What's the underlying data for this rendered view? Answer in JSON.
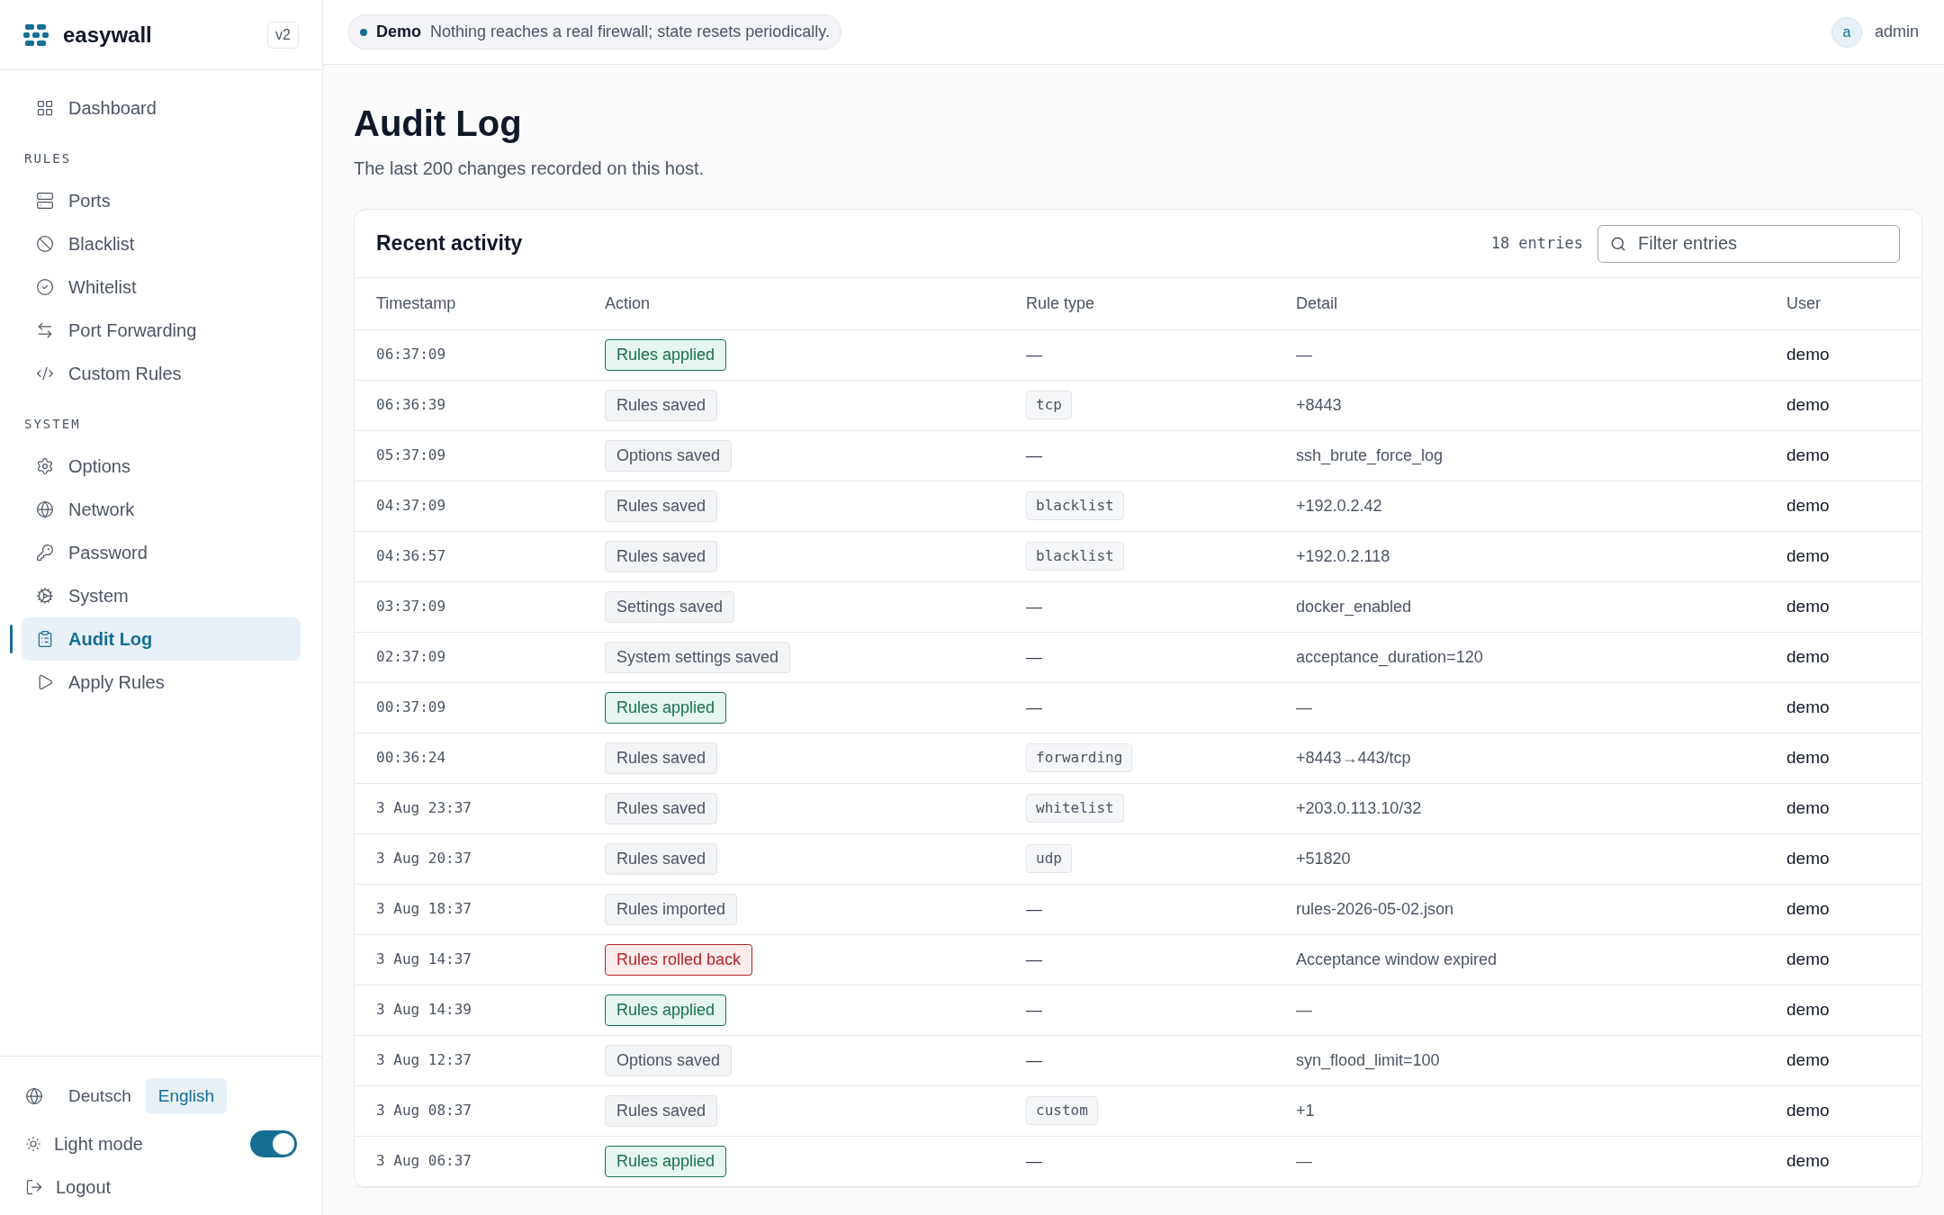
{
  "brand": {
    "name": "easywall",
    "version": "v2"
  },
  "sidebar": {
    "items": [
      {
        "label": "Dashboard",
        "selected": false
      }
    ],
    "sections": [
      {
        "heading": "RULES",
        "items": [
          {
            "label": "Ports",
            "selected": false
          },
          {
            "label": "Blacklist",
            "selected": false
          },
          {
            "label": "Whitelist",
            "selected": false
          },
          {
            "label": "Port Forwarding",
            "selected": false
          },
          {
            "label": "Custom Rules",
            "selected": false
          }
        ]
      },
      {
        "heading": "SYSTEM",
        "items": [
          {
            "label": "Options",
            "selected": false
          },
          {
            "label": "Network",
            "selected": false
          },
          {
            "label": "Password",
            "selected": false
          },
          {
            "label": "System",
            "selected": false
          },
          {
            "label": "Audit Log",
            "selected": true
          },
          {
            "label": "Apply Rules",
            "selected": false
          }
        ]
      }
    ],
    "languages": [
      {
        "label": "Deutsch",
        "selected": false
      },
      {
        "label": "English",
        "selected": true
      }
    ],
    "light_mode": {
      "label": "Light mode",
      "on": true
    },
    "logout": "Logout"
  },
  "banner": {
    "badge": "Demo",
    "text": "Nothing reaches a real firewall; state resets periodically."
  },
  "user": {
    "avatar": "a",
    "name": "admin"
  },
  "page": {
    "title": "Audit Log",
    "subtitle": "The last 200 changes recorded on this host."
  },
  "card": {
    "title": "Recent activity",
    "count": "18 entries",
    "search": {
      "placeholder": "Filter entries"
    }
  },
  "table": {
    "columns": [
      "Timestamp",
      "Action",
      "Rule type",
      "Detail",
      "User"
    ],
    "rows": [
      {
        "timestamp": "06:37:09",
        "action": {
          "text": "Rules applied",
          "kind": "success"
        },
        "rule_type": {
          "text": "—",
          "kind": "plain"
        },
        "detail": "—",
        "user": "demo"
      },
      {
        "timestamp": "06:36:39",
        "action": {
          "text": "Rules saved",
          "kind": "neutral"
        },
        "rule_type": {
          "text": "tcp",
          "kind": "tag"
        },
        "detail": "+8443",
        "user": "demo"
      },
      {
        "timestamp": "05:37:09",
        "action": {
          "text": "Options saved",
          "kind": "neutral"
        },
        "rule_type": {
          "text": "—",
          "kind": "plain"
        },
        "detail": "ssh_brute_force_log",
        "user": "demo"
      },
      {
        "timestamp": "04:37:09",
        "action": {
          "text": "Rules saved",
          "kind": "neutral"
        },
        "rule_type": {
          "text": "blacklist",
          "kind": "tag"
        },
        "detail": "+192.0.2.42",
        "user": "demo"
      },
      {
        "timestamp": "04:36:57",
        "action": {
          "text": "Rules saved",
          "kind": "neutral"
        },
        "rule_type": {
          "text": "blacklist",
          "kind": "tag"
        },
        "detail": "+192.0.2.118",
        "user": "demo"
      },
      {
        "timestamp": "03:37:09",
        "action": {
          "text": "Settings saved",
          "kind": "neutral"
        },
        "rule_type": {
          "text": "—",
          "kind": "plain"
        },
        "detail": "docker_enabled",
        "user": "demo"
      },
      {
        "timestamp": "02:37:09",
        "action": {
          "text": "System settings saved",
          "kind": "neutral"
        },
        "rule_type": {
          "text": "—",
          "kind": "plain"
        },
        "detail": "acceptance_duration=120",
        "user": "demo"
      },
      {
        "timestamp": "00:37:09",
        "action": {
          "text": "Rules applied",
          "kind": "success"
        },
        "rule_type": {
          "text": "—",
          "kind": "plain"
        },
        "detail": "—",
        "user": "demo"
      },
      {
        "timestamp": "00:36:24",
        "action": {
          "text": "Rules saved",
          "kind": "neutral"
        },
        "rule_type": {
          "text": "forwarding",
          "kind": "tag"
        },
        "detail": "+8443→443/tcp",
        "user": "demo"
      },
      {
        "timestamp": "3 Aug 23:37",
        "action": {
          "text": "Rules saved",
          "kind": "neutral"
        },
        "rule_type": {
          "text": "whitelist",
          "kind": "tag"
        },
        "detail": "+203.0.113.10/32",
        "user": "demo"
      },
      {
        "timestamp": "3 Aug 20:37",
        "action": {
          "text": "Rules saved",
          "kind": "neutral"
        },
        "rule_type": {
          "text": "udp",
          "kind": "tag"
        },
        "detail": "+51820",
        "user": "demo"
      },
      {
        "timestamp": "3 Aug 18:37",
        "action": {
          "text": "Rules imported",
          "kind": "neutral"
        },
        "rule_type": {
          "text": "—",
          "kind": "plain"
        },
        "detail": "rules-2026-05-02.json",
        "user": "demo"
      },
      {
        "timestamp": "3 Aug 14:37",
        "action": {
          "text": "Rules rolled back",
          "kind": "danger"
        },
        "rule_type": {
          "text": "—",
          "kind": "plain"
        },
        "detail": "Acceptance window expired",
        "user": "demo"
      },
      {
        "timestamp": "3 Aug 14:39",
        "action": {
          "text": "Rules applied",
          "kind": "success"
        },
        "rule_type": {
          "text": "—",
          "kind": "plain"
        },
        "detail": "—",
        "user": "demo"
      },
      {
        "timestamp": "3 Aug 12:37",
        "action": {
          "text": "Options saved",
          "kind": "neutral"
        },
        "rule_type": {
          "text": "—",
          "kind": "plain"
        },
        "detail": "syn_flood_limit=100",
        "user": "demo"
      },
      {
        "timestamp": "3 Aug 08:37",
        "action": {
          "text": "Rules saved",
          "kind": "neutral"
        },
        "rule_type": {
          "text": "custom",
          "kind": "tag"
        },
        "detail": "+1",
        "user": "demo"
      },
      {
        "timestamp": "3 Aug 06:37",
        "action": {
          "text": "Rules applied",
          "kind": "success"
        },
        "rule_type": {
          "text": "—",
          "kind": "plain"
        },
        "detail": "—",
        "user": "demo"
      }
    ]
  }
}
